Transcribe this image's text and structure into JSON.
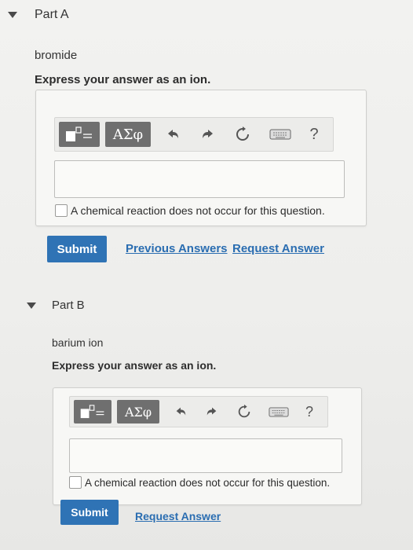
{
  "part_a": {
    "title": "Part A",
    "compound": "bromide",
    "prompt": "Express your answer as an ion.",
    "toolbar": {
      "greek_label": "ΑΣφ",
      "help_label": "?"
    },
    "answer_value": "",
    "checkbox_label": "A chemical reaction does not occur for this question.",
    "submit_label": "Submit",
    "previous_answers_label": "Previous Answers",
    "request_answer_label": "Request Answer"
  },
  "part_b": {
    "title": "Part B",
    "compound": "barium ion",
    "prompt": "Express your answer as an ion.",
    "toolbar": {
      "greek_label": "ΑΣφ",
      "help_label": "?"
    },
    "answer_value": "",
    "checkbox_label": "A chemical reaction does not occur for this question.",
    "submit_label": "Submit",
    "request_answer_label": "Request Answer"
  },
  "colors": {
    "submit_bg": "#2f73b5",
    "link": "#2a6db1",
    "toolbar_dark": "#6f6f6f"
  },
  "icons": [
    "collapse-caret-icon",
    "template-icon",
    "undo-icon",
    "redo-icon",
    "reset-icon",
    "keyboard-icon",
    "help-icon"
  ]
}
